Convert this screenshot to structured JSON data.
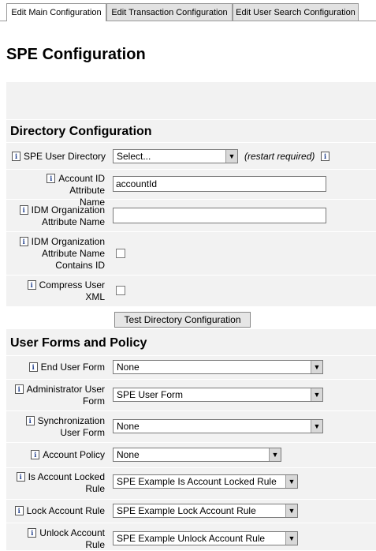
{
  "tabs": [
    {
      "label": "Edit Main Configuration",
      "active": true
    },
    {
      "label": "Edit Transaction Configuration",
      "active": false
    },
    {
      "label": "Edit User Search Configuration",
      "active": false
    }
  ],
  "page_title": "SPE Configuration",
  "info_icon_glyph": "i",
  "directory": {
    "heading": "Directory Configuration",
    "spe_user_directory": {
      "label": "SPE User Directory",
      "value": "Select...",
      "note": "(restart required)"
    },
    "account_id_attr": {
      "label_1": "Account ID Attribute",
      "label_2": "Name",
      "value": "accountId"
    },
    "idm_org_attr": {
      "label_1": "IDM Organization",
      "label_2": "Attribute Name",
      "value": ""
    },
    "idm_org_contains_id": {
      "label_1": "IDM Organization",
      "label_2": "Attribute Name",
      "label_3": "Contains ID",
      "checked": false
    },
    "compress_user_xml": {
      "label_1": "Compress User",
      "label_2": "XML",
      "checked": false
    },
    "test_button": "Test Directory Configuration"
  },
  "forms": {
    "heading": "User Forms and Policy",
    "end_user_form": {
      "label": "End User Form",
      "value": "None"
    },
    "admin_user_form": {
      "label_1": "Administrator User",
      "label_2": "Form",
      "value": "SPE User Form"
    },
    "sync_user_form": {
      "label_1": "Synchronization",
      "label_2": "User Form",
      "value": "None"
    },
    "account_policy": {
      "label": "Account Policy",
      "value": "None"
    },
    "is_locked_rule": {
      "label_1": "Is Account Locked",
      "label_2": "Rule",
      "value": "SPE Example Is Account Locked Rule"
    },
    "lock_rule": {
      "label": "Lock Account Rule",
      "value": "SPE Example Lock Account Rule"
    },
    "unlock_rule": {
      "label_1": "Unlock Account",
      "label_2": "Rule",
      "value": "SPE Example Unlock Account Rule"
    }
  },
  "colors": {
    "band": "#f2f2f2",
    "tab_inactive": "#e2e2e2",
    "info_icon": "#1a3a8a"
  }
}
